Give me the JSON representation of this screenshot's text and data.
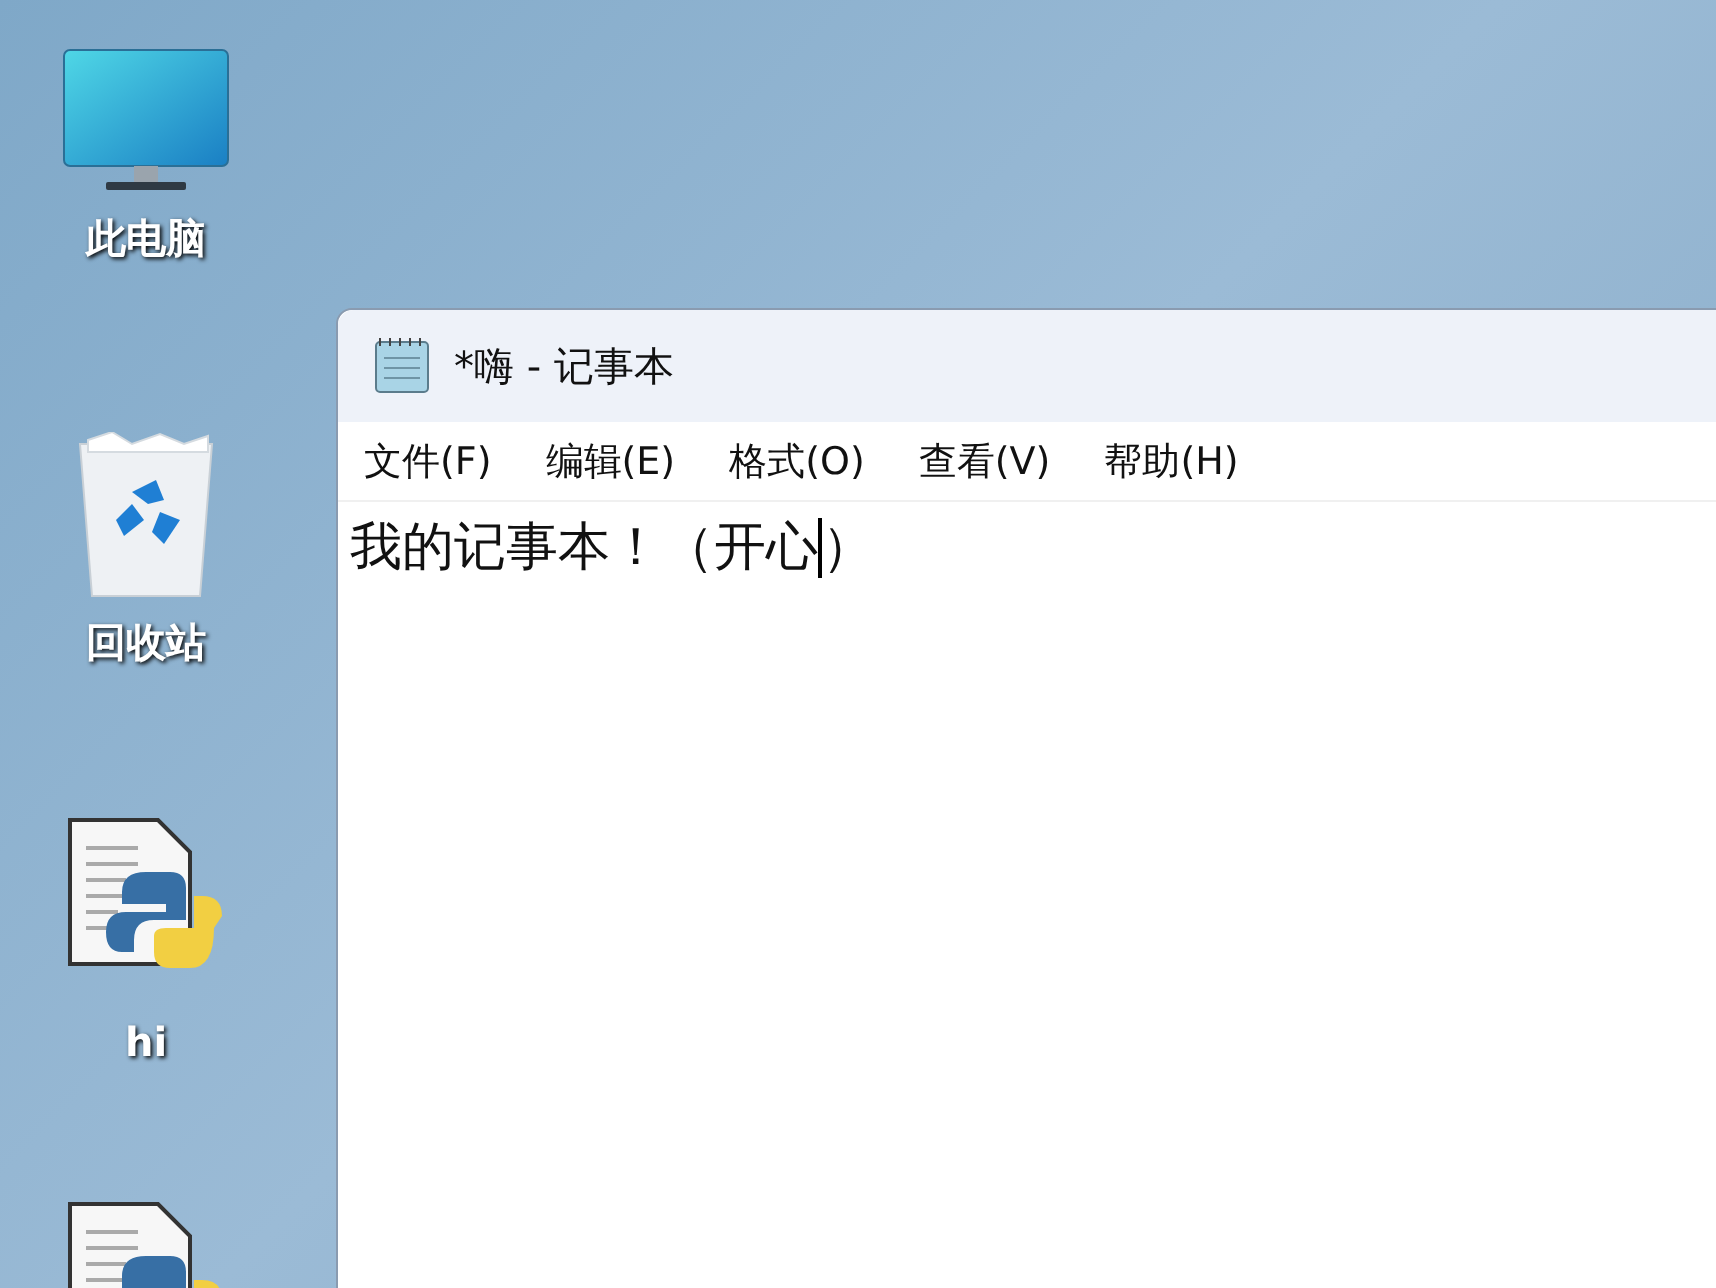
{
  "desktop_icons": [
    {
      "kind": "computer",
      "label": "此电脑"
    },
    {
      "kind": "recycle-bin",
      "label": "回收站"
    },
    {
      "kind": "python-file",
      "label": "hi"
    },
    {
      "kind": "python-file"
    }
  ],
  "window": {
    "title": "*嗨 - 记事本",
    "menu": [
      "文件(F)",
      "编辑(E)",
      "格式(O)",
      "查看(V)",
      "帮助(H)"
    ],
    "editor": {
      "text_before_cursor": "我的记事本！（开心",
      "text_after_cursor": "）"
    }
  }
}
